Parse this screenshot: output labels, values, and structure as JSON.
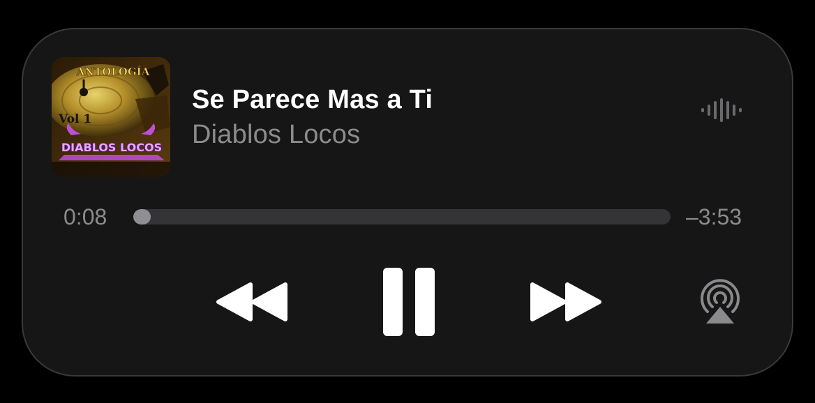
{
  "now_playing": {
    "title": "Se Parece Mas a Ti",
    "artist": "Diablos Locos",
    "artwork": {
      "top_text": "ANTOLOGÍA",
      "volume_text": "Vol 1",
      "logo_text": "DIABLOS LOCOS"
    }
  },
  "progress": {
    "elapsed": "0:08",
    "remaining": "–3:53",
    "fraction": 0.033
  },
  "controls": {
    "rewind_icon": "backward-icon",
    "pause_icon": "pause-icon",
    "forward_icon": "forward-icon",
    "airplay_icon": "airplay-icon",
    "waveform_icon": "waveform-icon"
  },
  "colors": {
    "background": "#161616",
    "title": "#ffffff",
    "secondary": "#8c8c8e",
    "track": "#343436",
    "fill": "#8e8e93"
  }
}
